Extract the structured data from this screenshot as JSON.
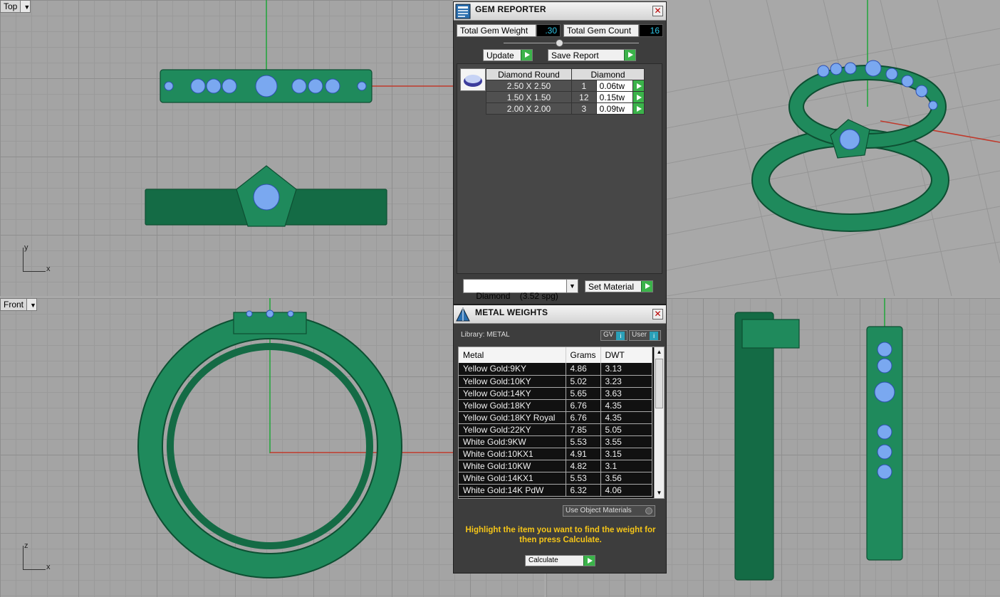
{
  "viewports": {
    "top": {
      "label": "Top",
      "axis_y": "y",
      "axis_x": "x"
    },
    "front": {
      "label": "Front",
      "axis_y": "z",
      "axis_x": "x"
    }
  },
  "gem_reporter": {
    "title": "GEM REPORTER",
    "total_weight_label": "Total Gem Weight",
    "total_weight_value": ".30",
    "total_count_label": "Total Gem Count",
    "total_count_value": "16",
    "update_label": "Update",
    "save_report_label": "Save Report",
    "table_header_shape": "Diamond Round",
    "table_header_material": "Diamond",
    "rows": [
      {
        "size": "2.50 X 2.50",
        "count": "1",
        "weight": "0.06tw"
      },
      {
        "size": "1.50 X 1.50",
        "count": "12",
        "weight": "0.15tw"
      },
      {
        "size": "2.00 X 2.00",
        "count": "3",
        "weight": "0.09tw"
      }
    ],
    "material_select": "Diamond    (3.52 spg)",
    "set_material_label": "Set Material"
  },
  "metal_weights": {
    "title": "METAL WEIGHTS",
    "library_label": "Library: METAL",
    "gv_label": "GV",
    "user_label": "User",
    "col_metal": "Metal",
    "col_grams": "Grams",
    "col_dwt": "DWT",
    "rows": [
      {
        "metal": "Yellow Gold:9KY",
        "grams": "4.86",
        "dwt": "3.13"
      },
      {
        "metal": "Yellow Gold:10KY",
        "grams": "5.02",
        "dwt": "3.23"
      },
      {
        "metal": "Yellow Gold:14KY",
        "grams": "5.65",
        "dwt": "3.63"
      },
      {
        "metal": "Yellow Gold:18KY",
        "grams": "6.76",
        "dwt": "4.35"
      },
      {
        "metal": "Yellow Gold:18KY Royal",
        "grams": "6.76",
        "dwt": "4.35"
      },
      {
        "metal": "Yellow Gold:22KY",
        "grams": "7.85",
        "dwt": "5.05"
      },
      {
        "metal": "White Gold:9KW",
        "grams": "5.53",
        "dwt": "3.55"
      },
      {
        "metal": "White Gold:10KX1",
        "grams": "4.91",
        "dwt": "3.15"
      },
      {
        "metal": "White Gold:10KW",
        "grams": "4.82",
        "dwt": "3.1"
      },
      {
        "metal": "White Gold:14KX1",
        "grams": "5.53",
        "dwt": "3.56"
      },
      {
        "metal": "White Gold:14K PdW",
        "grams": "6.32",
        "dwt": "4.06"
      }
    ],
    "use_object_materials": "Use Object Materials",
    "hint": "Highlight the item you want to find the weight for then press Calculate.",
    "calculate_label": "Calculate"
  }
}
